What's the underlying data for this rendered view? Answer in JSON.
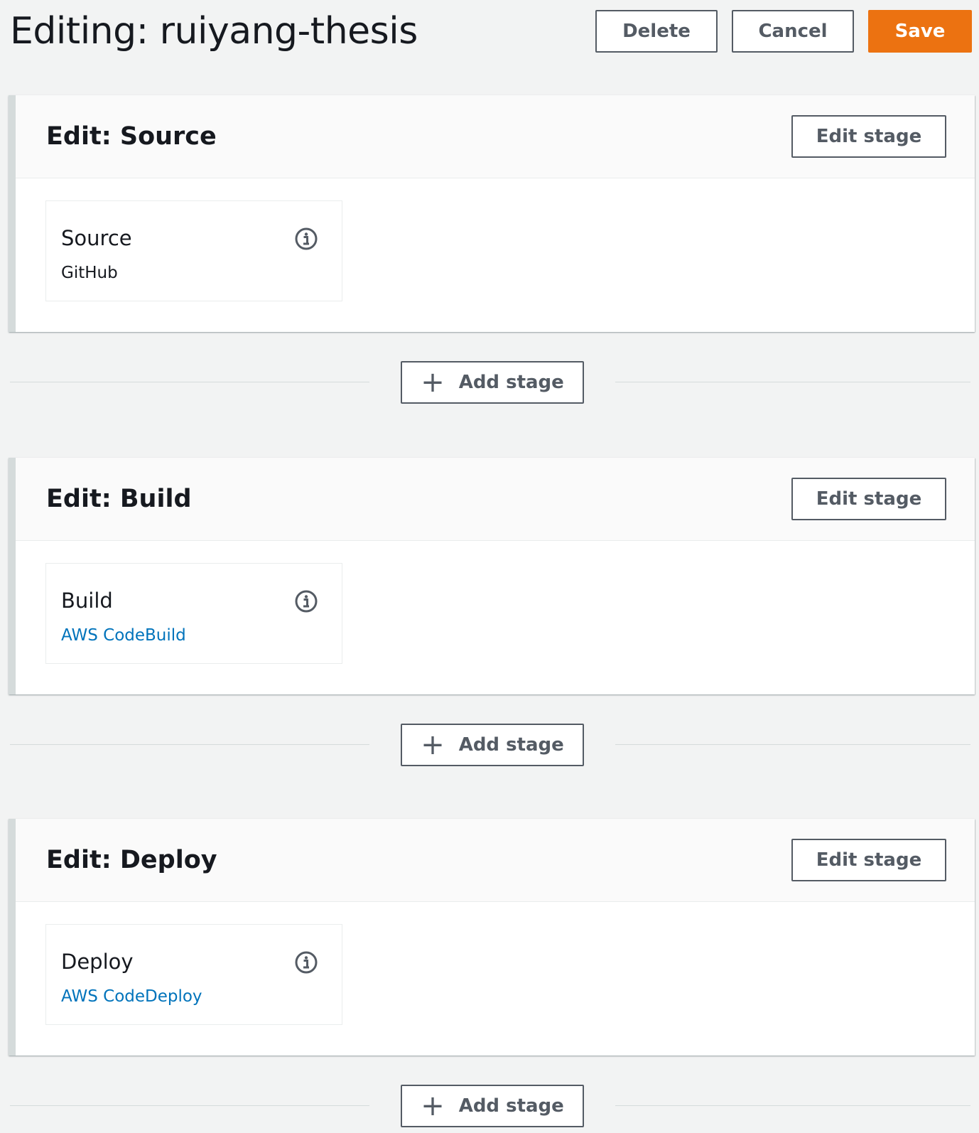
{
  "header": {
    "title": "Editing: ruiyang-thesis",
    "delete_label": "Delete",
    "cancel_label": "Cancel",
    "save_label": "Save"
  },
  "stages": [
    {
      "title": "Edit: Source",
      "edit_label": "Edit stage",
      "action": {
        "name": "Source",
        "provider": "GitHub",
        "provider_is_link": false
      }
    },
    {
      "title": "Edit: Build",
      "edit_label": "Edit stage",
      "action": {
        "name": "Build",
        "provider": "AWS CodeBuild",
        "provider_is_link": true
      }
    },
    {
      "title": "Edit: Deploy",
      "edit_label": "Edit stage",
      "action": {
        "name": "Deploy",
        "provider": "AWS CodeDeploy",
        "provider_is_link": true
      }
    }
  ],
  "add_stage_label": "Add stage",
  "icons": {
    "info": "info-icon",
    "add": "plus-icon"
  },
  "colors": {
    "primary": "#ec7211",
    "link": "#0073bb",
    "border": "#545b64",
    "background": "#f2f3f3"
  }
}
